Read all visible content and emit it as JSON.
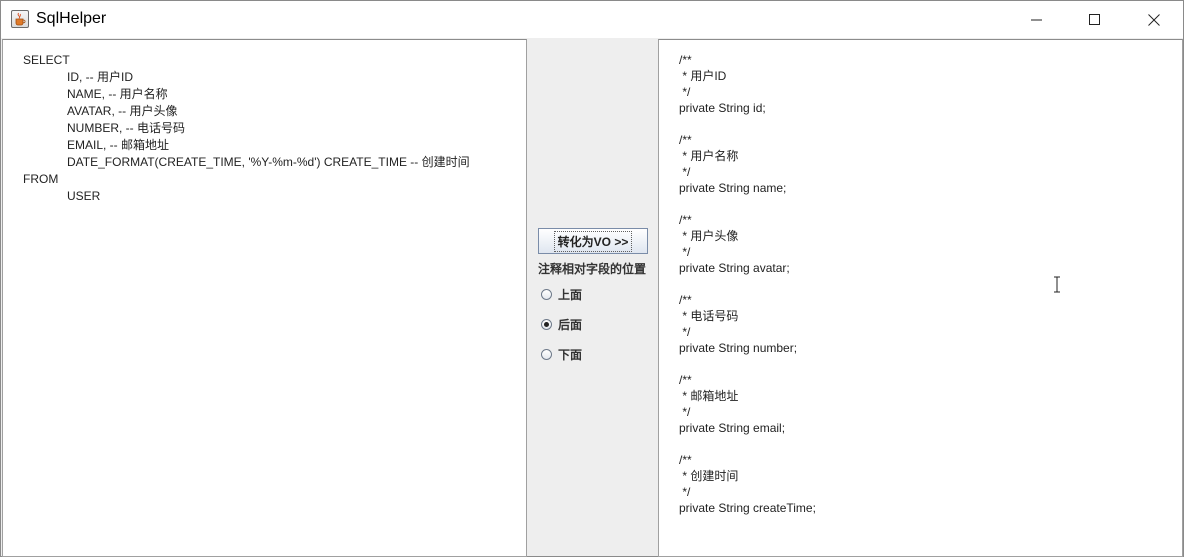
{
  "window": {
    "title": "SqlHelper"
  },
  "sql_editor": {
    "lines": [
      {
        "text": "SELECT",
        "indent": false
      },
      {
        "text": "ID, -- 用户ID",
        "indent": true
      },
      {
        "text": "NAME, -- 用户名称",
        "indent": true
      },
      {
        "text": "AVATAR, -- 用户头像",
        "indent": true
      },
      {
        "text": "NUMBER, -- 电话号码",
        "indent": true
      },
      {
        "text": "EMAIL, -- 邮箱地址",
        "indent": true
      },
      {
        "text": "DATE_FORMAT(CREATE_TIME, '%Y-%m-%d') CREATE_TIME -- 创建时间",
        "indent": true
      },
      {
        "text": "FROM",
        "indent": false
      },
      {
        "text": "USER",
        "indent": true
      }
    ]
  },
  "controls": {
    "convert_label": "转化为VO >>",
    "comment_position_label": "注释相对字段的位置",
    "options": [
      {
        "label": "上面",
        "checked": false
      },
      {
        "label": "后面",
        "checked": true
      },
      {
        "label": "下面",
        "checked": false
      }
    ]
  },
  "vo_output": {
    "lines": [
      "/**",
      " * 用户ID",
      " */",
      "private String id;",
      "",
      "/**",
      " * 用户名称",
      " */",
      "private String name;",
      "",
      "/**",
      " * 用户头像",
      " */",
      "private String avatar;",
      "",
      "/**",
      " * 电话号码",
      " */",
      "private String number;",
      "",
      "/**",
      " * 邮箱地址",
      " */",
      "private String email;",
      "",
      "/**",
      " * 创建时间",
      " */",
      "private String createTime;"
    ]
  },
  "icons": {
    "app": "java-cup-icon",
    "minimize": "minimize-icon",
    "maximize": "maximize-icon",
    "close": "close-icon"
  }
}
